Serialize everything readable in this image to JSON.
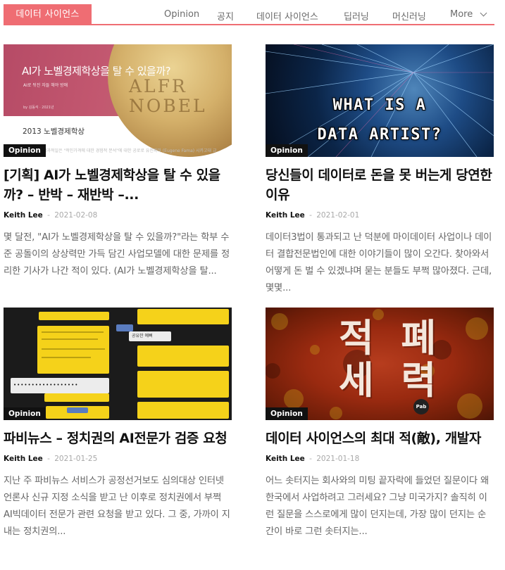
{
  "header": {
    "brand": "데이터 사이언스",
    "nav": [
      "Opinion",
      "공지",
      "데이터 사이언스",
      "딥러닝",
      "머신러닝"
    ],
    "more": "More"
  },
  "colors": {
    "accent": "#ef6d73",
    "badge": "#111111"
  },
  "posts": [
    {
      "badge": "Opinion",
      "title": "[기획] AI가 노벨경제학상을 탈 수 있을까? – 반박 – 재반박 –...",
      "author": "Keith Lee",
      "sep": "-",
      "date": "2021-02-08",
      "excerpt": "몇 달전, \"AI가 노벨경제학상을 탈 수 있을까?\"라는 학부 수준 공돌이의 상상력만 가득 담긴 사업모델에 대한 문제를 정리한 기사가 나간 적이 있다. (AI가 노벨경제학상을 탈...",
      "thumb": {
        "headline": "AI가 노벨경제학상을 탈 수 있을까?",
        "sub": "AI로 뒤진 자들 해야 방애",
        "by": "by 김동석 · 2021년",
        "coin": "ALFR NOBEL",
        "year_title": "2013 노벨경제학상",
        "small_text": "탑과적일은 \"적인가격에 대한 경험적 분석\"에 대한 공로로 유진파마 (Eugene Fama) 시카고대 교"
      }
    },
    {
      "badge": "Opinion",
      "title": "당신들이 데이터로 돈을 못 버는게 당연한 이유",
      "author": "Keith Lee",
      "sep": "-",
      "date": "2021-02-01",
      "excerpt": "데이터3법이 통과되고 난 덕분에 마이데이터 사업이나 데이터 결합전문법인에 대한 이야기들이 많이 오간다. 찾아와서 어떻게 돈 벌 수 있겠냐며 묻는 분들도 부쩍 많아졌다. 근데, 몇몇...",
      "thumb": {
        "line1": "WHAT IS A",
        "line2": "DATA ARTIST?"
      }
    },
    {
      "badge": "Opinion",
      "title": "파비뉴스 – 정치권의 AI전문가 검증 요청",
      "author": "Keith Lee",
      "sep": "-",
      "date": "2021-01-25",
      "excerpt": "지난 주 파비뉴스 서비스가 공정선거보도 심의대상 인터넷언론사 신규 지정 소식을 받고 난 이후로 정치권에서 부쩍 AI빅데이터 전문가 관련 요청을 받고 있다. 그 중, 가까이 지내는 정치권의...",
      "thumb": {
        "dots": "••••••••••••••••••",
        "reply": "공유한 예뻐"
      }
    },
    {
      "badge": "Opinion",
      "title": "데이터 사이언스의 최대 적(敵), 개발자",
      "author": "Keith Lee",
      "sep": "-",
      "date": "2021-01-18",
      "excerpt": "어느 솟터지는 회사와의 미팅 끝자락에 들었던 질문이다 왜 한국에서 사업하려고 그러세요? 그냥 미국가지? 솔직히 이런 질문을 스스로에게 많이 던지는데, 가장 많이 던지는 순간이 바로 그런 솟터지는...",
      "thumb": {
        "line1": "적 폐",
        "line2": "세 력",
        "logo": "Pab"
      }
    }
  ]
}
